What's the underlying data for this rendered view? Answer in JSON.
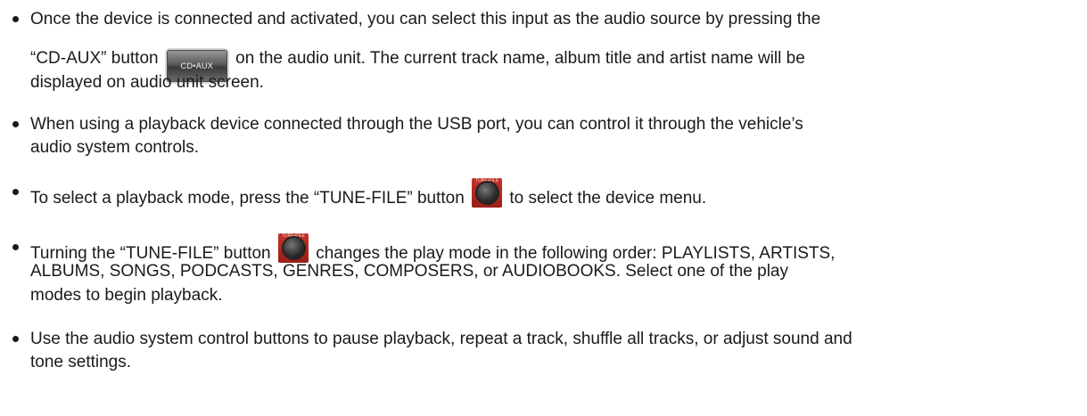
{
  "bullets": [
    {
      "line1": "Once the device is connected and activated, you can select this input as the audio source by pressing the",
      "line2_before": "“CD-AUX” button",
      "line2_after": "on the audio unit. The current track name, album title and artist name will be",
      "line3": "displayed on audio unit screen."
    },
    {
      "line1": "When using a playback device connected through the USB port, you can control it through the vehicle’s",
      "line2": "audio system controls."
    },
    {
      "before": "To select a playback mode, press the “TUNE-FILE” button",
      "after": "to select the device menu."
    },
    {
      "line1_before": "Turning the “TUNE-FILE” button",
      "line1_after": "changes the play mode in the following order: PLAYLISTS, ARTISTS,",
      "line2": "ALBUMS, SONGS, PODCASTS, GENRES, COMPOSERS, or AUDIOBOOKS. Select one of the play",
      "line3": "modes to begin playback."
    },
    {
      "line1": "Use the audio system control buttons to pause playback, repeat a track, shuffle all tracks, or adjust sound and",
      "line2": "tone settings."
    }
  ],
  "icons": {
    "cd_aux": {
      "name": "cd-aux-button-icon",
      "label": "CD•AUX"
    },
    "tune_file": {
      "name": "tune-file-knob-icon",
      "label": "TUNE•FILE"
    }
  }
}
